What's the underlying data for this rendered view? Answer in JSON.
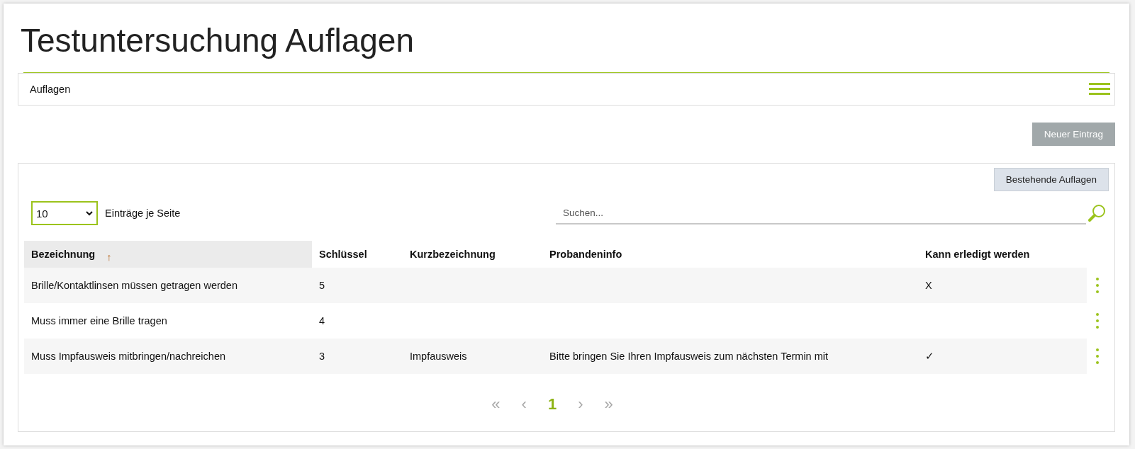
{
  "page": {
    "title": "Testuntersuchung Auflagen"
  },
  "breadcrumb": {
    "label": "Auflagen"
  },
  "actions": {
    "new_entry": "Neuer Eintrag"
  },
  "panel": {
    "existing_button": "Bestehende Auflagen",
    "page_size": {
      "value": "10",
      "label": "Einträge je Seite"
    },
    "search": {
      "placeholder": "Suchen..."
    },
    "table": {
      "columns": [
        {
          "label": "Bezeichnung",
          "sorted": true,
          "sort_icon": "↑"
        },
        {
          "label": "Schlüssel",
          "sorted": false
        },
        {
          "label": "Kurzbezeichnung",
          "sorted": false
        },
        {
          "label": "Probandeninfo",
          "sorted": false
        },
        {
          "label": "Kann erledigt werden",
          "sorted": false
        }
      ],
      "rows": [
        {
          "cells": [
            "Brille/Kontaktlinsen müssen getragen werden",
            "5",
            null,
            null,
            "X"
          ]
        },
        {
          "cells": [
            "Muss immer eine Brille tragen",
            "4",
            null,
            null,
            null
          ]
        },
        {
          "cells": [
            "Muss Impfausweis mitbringen/nachreichen",
            "3",
            "Impfausweis",
            "Bitte bringen Sie Ihren Impfausweis zum nächsten Termin mit",
            "✓"
          ]
        }
      ]
    },
    "pagination": [
      {
        "label": "«",
        "disabled": true,
        "selected": false
      },
      {
        "label": "‹",
        "disabled": true,
        "selected": false
      },
      {
        "label": "1",
        "disabled": false,
        "selected": true
      },
      {
        "label": "›",
        "disabled": true,
        "selected": false
      },
      {
        "label": "»",
        "disabled": true,
        "selected": false
      }
    ]
  }
}
